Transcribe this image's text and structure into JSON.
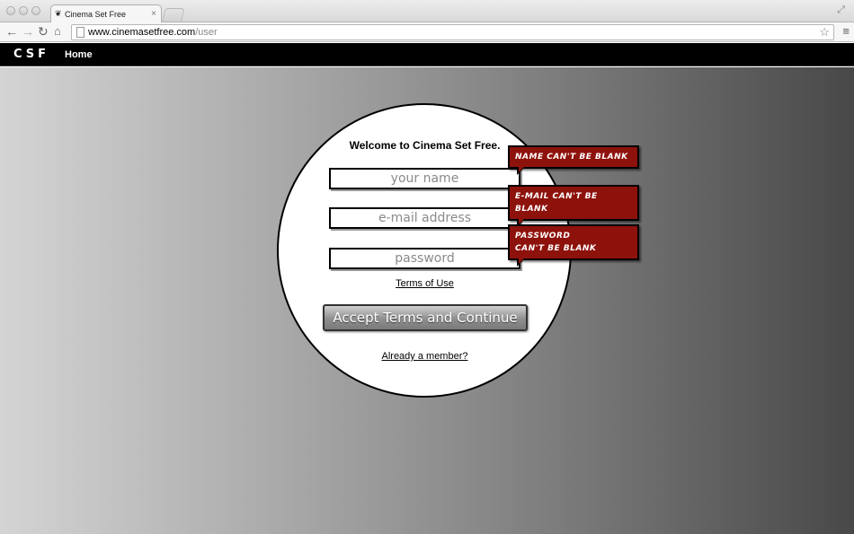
{
  "browser": {
    "tab_title": "Cinema Set Free",
    "favicon_glyph": "❦",
    "close_glyph": "×",
    "url_host": "www.cinemasetfree.com",
    "url_path": "/user",
    "icons": [
      "back-arrow-icon",
      "forward-arrow-icon",
      "reload-icon",
      "home-icon",
      "page-icon",
      "star-icon",
      "menu-icon",
      "fullscreen-icon"
    ]
  },
  "site": {
    "logo": "CSF",
    "nav_home": "Home"
  },
  "form": {
    "welcome": "Welcome to Cinema Set Free.",
    "name_placeholder": "your name",
    "email_placeholder": "e-mail address",
    "password_placeholder": "password",
    "terms_link": "Terms of Use",
    "submit_label": "Accept Terms and Continue",
    "member_link": "Already a member?"
  },
  "errors": {
    "name": "Name can't be blank",
    "email": "E-mail can't be blank",
    "password_line1": "Password",
    "password_line2": "can't be blank",
    "color": "#8e120c"
  }
}
